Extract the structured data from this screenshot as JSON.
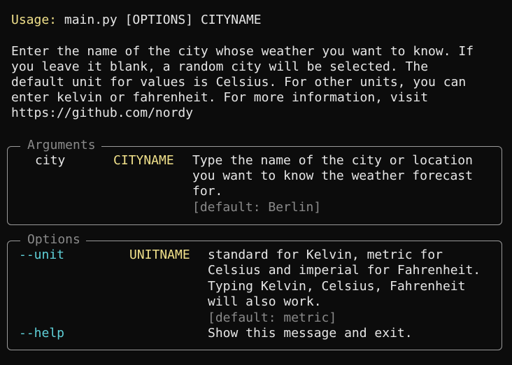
{
  "usage": {
    "label": "Usage:",
    "command": "main.py [OPTIONS] CITYNAME"
  },
  "description": {
    "lines": [
      "Enter the name of the city whose weather you want to know. If",
      "you leave it blank, a random city will be selected. The",
      "default unit for values is Celsius. For other units, you can",
      "enter kelvin or fahrenheit. For more information, visit",
      "https://github.com/nordy"
    ]
  },
  "arguments": {
    "title": "Arguments",
    "items": [
      {
        "name": "city",
        "metavar": "CITYNAME",
        "help_lines": [
          "Type the name of the city or location",
          "you want to know the weather forecast",
          "for."
        ],
        "default": "[default: Berlin]"
      }
    ]
  },
  "options": {
    "title": "Options",
    "items": [
      {
        "name": "--unit",
        "metavar": "UNITNAME",
        "help_lines": [
          "standard for Kelvin, metric for",
          "Celsius and imperial for Fahrenheit.",
          "Typing Kelvin, Celsius, Fahrenheit",
          "will also work."
        ],
        "default": "[default: metric]"
      },
      {
        "name": "--help",
        "metavar": "",
        "help_lines": [
          "Show this message and exit."
        ],
        "default": ""
      }
    ]
  },
  "colors": {
    "background": "#0c0c0c",
    "text": "#e6e6e6",
    "yellow": "#f0e08a",
    "cyan": "#5fd0d8",
    "dim": "#8a8a8a",
    "border": "#9a9a9a"
  }
}
